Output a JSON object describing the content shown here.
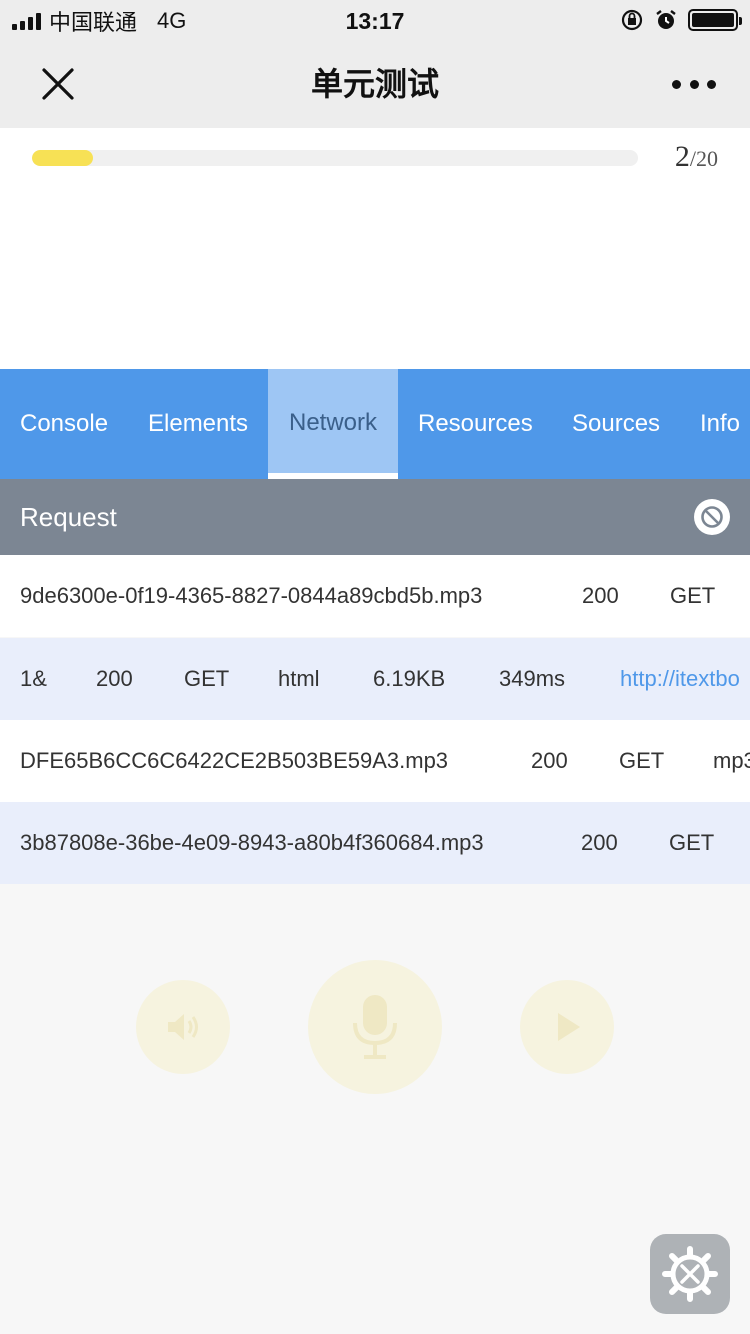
{
  "status_bar": {
    "carrier": "中国联通",
    "network": "4G",
    "time": "13:17"
  },
  "navbar": {
    "title": "单元测试",
    "close_icon": "close-icon",
    "more_icon": "more-dots-icon"
  },
  "progress": {
    "current": "2",
    "total": "/20",
    "fraction": 0.1,
    "fill_color": "#f7e155"
  },
  "devtools": {
    "tabs": [
      {
        "label": "Console"
      },
      {
        "label": "Elements"
      },
      {
        "label": "Network"
      },
      {
        "label": "Resources"
      },
      {
        "label": "Sources"
      },
      {
        "label": "Info"
      }
    ],
    "active_tab": "Network",
    "accent_color": "#4f98e9",
    "request_header": "Request",
    "clear_icon": "clear-icon"
  },
  "requests": [
    {
      "name": "9de6300e-0f19-4365-8827-0844a89cbd5b.mp3",
      "status": "200",
      "method": "GET"
    },
    {
      "name": "1&",
      "status": "200",
      "method": "GET",
      "type": "html",
      "size": "6.19KB",
      "time": "349ms",
      "url": "http://itextbo"
    },
    {
      "name": "DFE65B6CC6C6422CE2B503BE59A3.mp3",
      "status": "200",
      "method": "GET",
      "type": "mp3"
    },
    {
      "name": "3b87808e-36be-4e09-8943-a80b4f360684.mp3",
      "status": "200",
      "method": "GET"
    }
  ],
  "controls": {
    "speaker_icon": "speaker-icon",
    "mic_icon": "microphone-icon",
    "play_icon": "play-icon",
    "settings_icon": "settings-gear-icon"
  }
}
